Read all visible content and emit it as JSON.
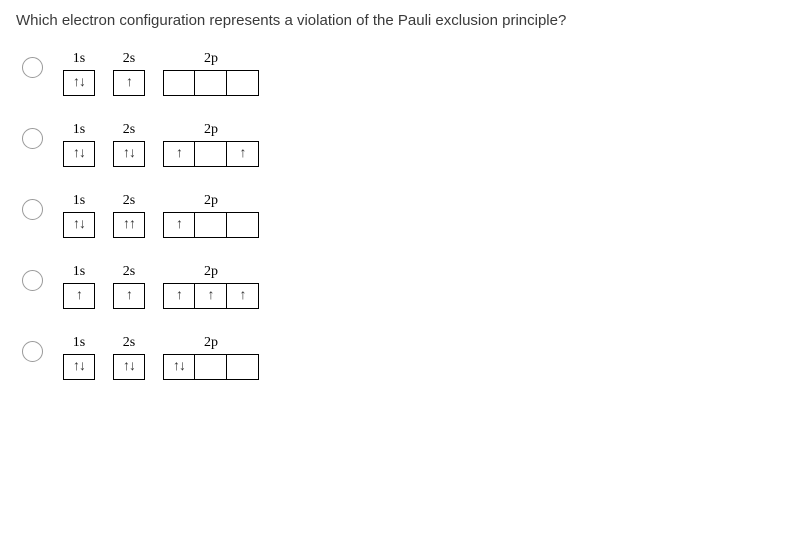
{
  "question": "Which electron configuration represents a violation of the Pauli exclusion principle?",
  "labels": {
    "s1": "1s",
    "s2": "2s",
    "p2": "2p"
  },
  "options": [
    {
      "s1": [
        "↑↓"
      ],
      "s2": [
        "↑"
      ],
      "p2": [
        "",
        "",
        ""
      ]
    },
    {
      "s1": [
        "↑↓"
      ],
      "s2": [
        "↑↓"
      ],
      "p2": [
        "↑",
        "",
        "↑"
      ]
    },
    {
      "s1": [
        "↑↓"
      ],
      "s2": [
        "↑↑"
      ],
      "p2": [
        "↑",
        "",
        ""
      ]
    },
    {
      "s1": [
        "↑"
      ],
      "s2": [
        "↑"
      ],
      "p2": [
        "↑",
        "↑",
        "↑"
      ]
    },
    {
      "s1": [
        "↑↓"
      ],
      "s2": [
        "↑↓"
      ],
      "p2": [
        "↑↓",
        "",
        ""
      ]
    }
  ]
}
